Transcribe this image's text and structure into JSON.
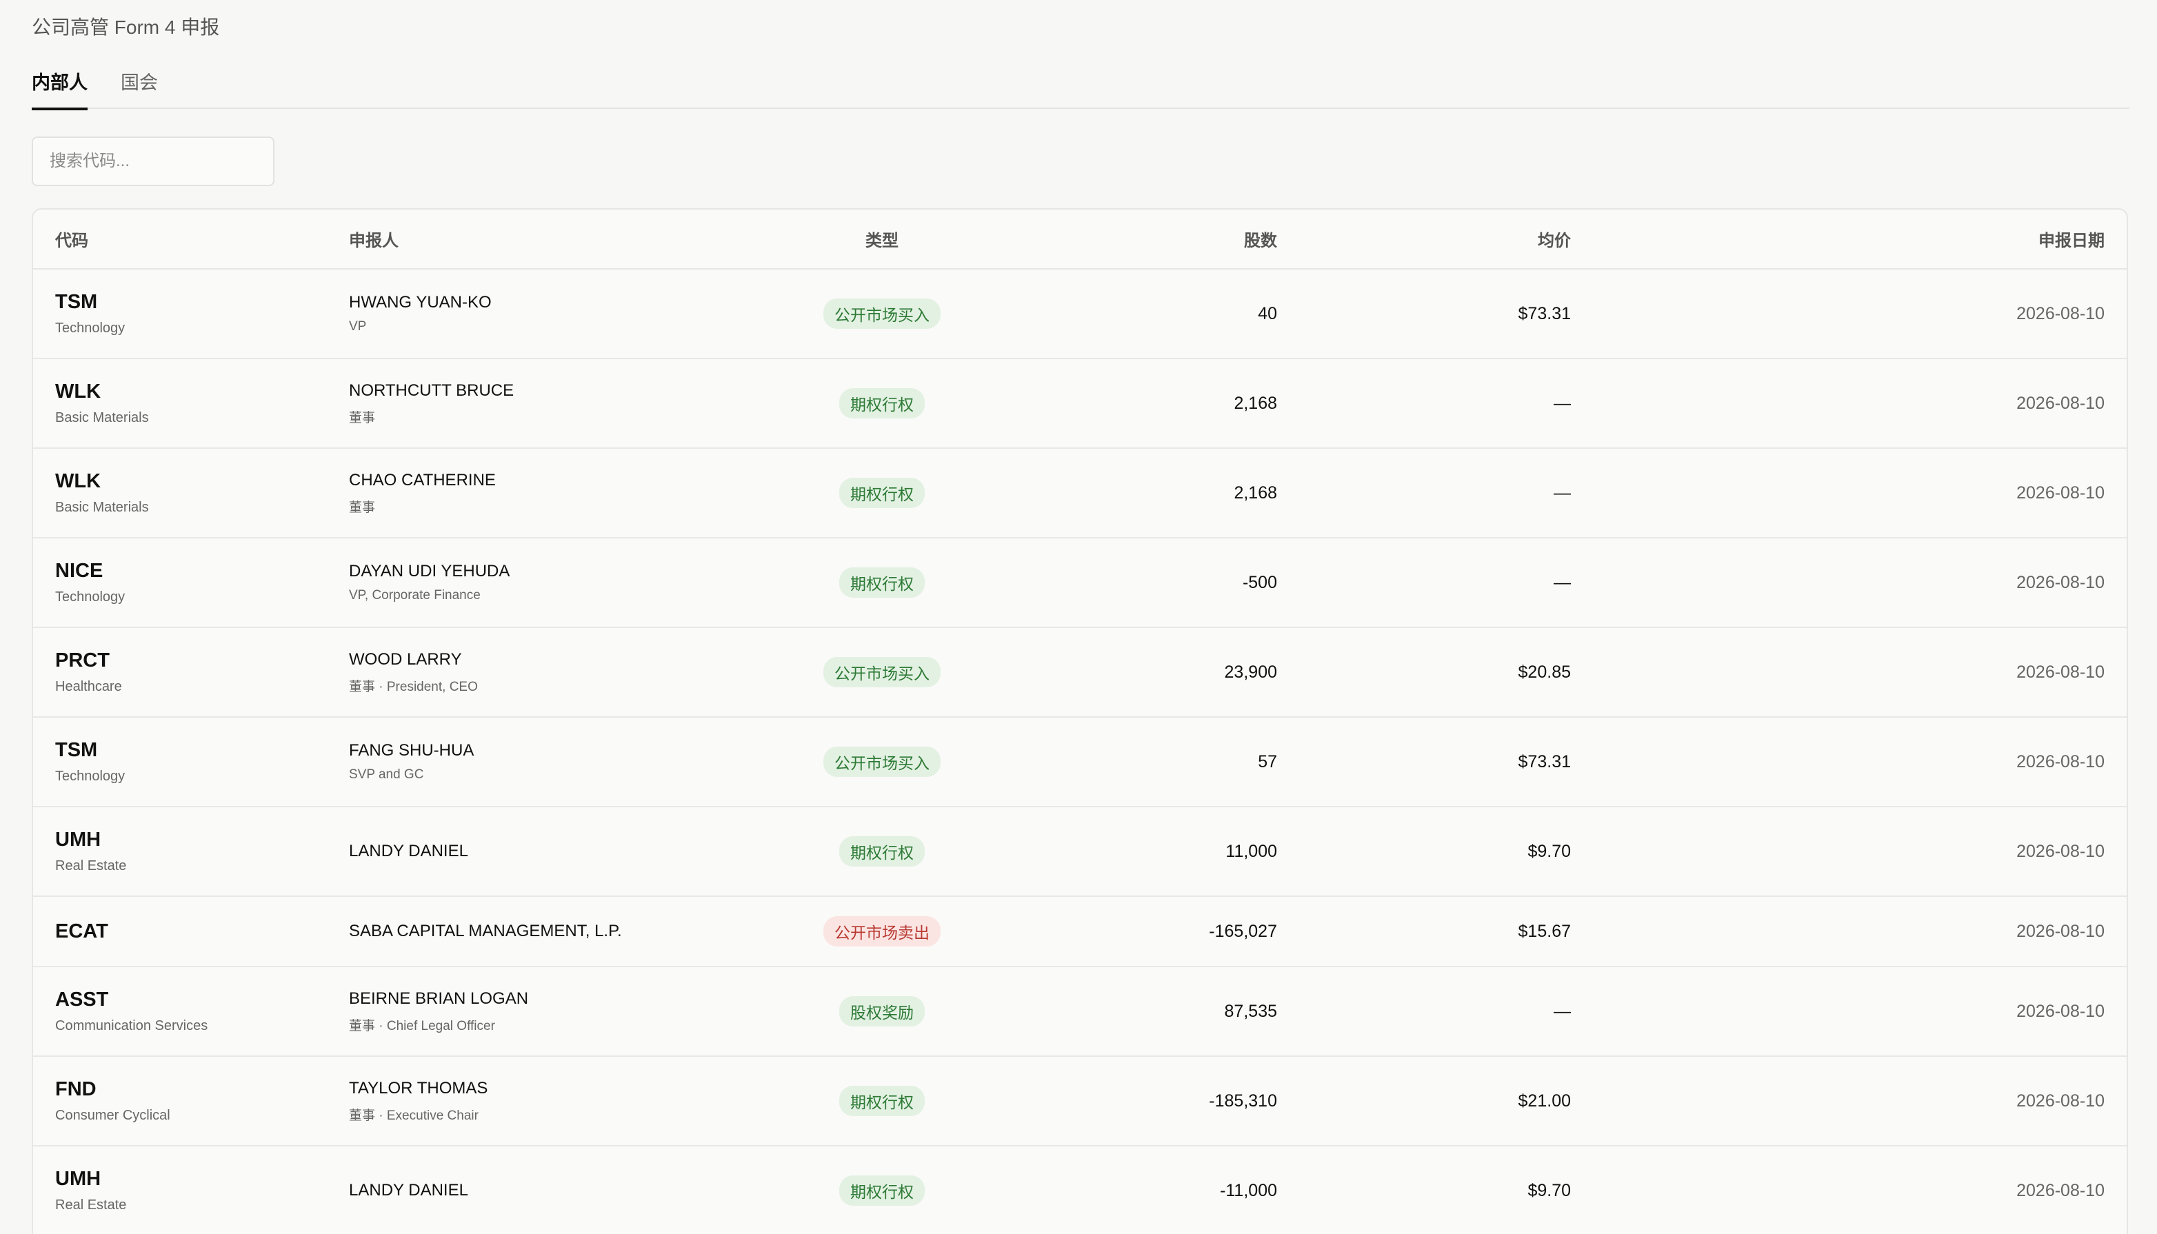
{
  "page_title": "公司高管 Form 4 申报",
  "tabs": [
    {
      "label": "内部人",
      "active": true
    },
    {
      "label": "国会",
      "active": false
    }
  ],
  "search": {
    "placeholder": "搜索代码..."
  },
  "table": {
    "headers": {
      "ticker": "代码",
      "filer": "申报人",
      "type": "类型",
      "shares": "股数",
      "avg_price": "均价",
      "date": "申报日期"
    },
    "rows": [
      {
        "ticker": "TSM",
        "sector": "Technology",
        "filer": "HWANG YUAN-KO",
        "role": "VP",
        "type": "公开市场买入",
        "type_color": "green",
        "shares": "40",
        "price": "$73.31",
        "date": "2026-08-10"
      },
      {
        "ticker": "WLK",
        "sector": "Basic Materials",
        "filer": "NORTHCUTT BRUCE",
        "role": "董事",
        "type": "期权行权",
        "type_color": "green",
        "shares": "2,168",
        "price": "—",
        "date": "2026-08-10"
      },
      {
        "ticker": "WLK",
        "sector": "Basic Materials",
        "filer": "CHAO CATHERINE",
        "role": "董事",
        "type": "期权行权",
        "type_color": "green",
        "shares": "2,168",
        "price": "—",
        "date": "2026-08-10"
      },
      {
        "ticker": "NICE",
        "sector": "Technology",
        "filer": "DAYAN UDI YEHUDA",
        "role": "VP, Corporate Finance",
        "type": "期权行权",
        "type_color": "green",
        "shares": "-500",
        "price": "—",
        "date": "2026-08-10"
      },
      {
        "ticker": "PRCT",
        "sector": "Healthcare",
        "filer": "WOOD LARRY",
        "role": "董事 · President, CEO",
        "type": "公开市场买入",
        "type_color": "green",
        "shares": "23,900",
        "price": "$20.85",
        "date": "2026-08-10"
      },
      {
        "ticker": "TSM",
        "sector": "Technology",
        "filer": "FANG SHU-HUA",
        "role": "SVP and GC",
        "type": "公开市场买入",
        "type_color": "green",
        "shares": "57",
        "price": "$73.31",
        "date": "2026-08-10"
      },
      {
        "ticker": "UMH",
        "sector": "Real Estate",
        "filer": "LANDY DANIEL",
        "role": "",
        "type": "期权行权",
        "type_color": "green",
        "shares": "11,000",
        "price": "$9.70",
        "date": "2026-08-10"
      },
      {
        "ticker": "ECAT",
        "sector": "",
        "filer": "SABA CAPITAL MANAGEMENT, L.P.",
        "role": "",
        "type": "公开市场卖出",
        "type_color": "red",
        "shares": "-165,027",
        "price": "$15.67",
        "date": "2026-08-10"
      },
      {
        "ticker": "ASST",
        "sector": "Communication Services",
        "filer": "BEIRNE BRIAN LOGAN",
        "role": "董事 · Chief Legal Officer",
        "type": "股权奖励",
        "type_color": "green",
        "shares": "87,535",
        "price": "—",
        "date": "2026-08-10"
      },
      {
        "ticker": "FND",
        "sector": "Consumer Cyclical",
        "filer": "TAYLOR THOMAS",
        "role": "董事 · Executive Chair",
        "type": "期权行权",
        "type_color": "green",
        "shares": "-185,310",
        "price": "$21.00",
        "date": "2026-08-10"
      },
      {
        "ticker": "UMH",
        "sector": "Real Estate",
        "filer": "LANDY DANIEL",
        "role": "",
        "type": "期权行权",
        "type_color": "green",
        "shares": "-11,000",
        "price": "$9.70",
        "date": "2026-08-10"
      }
    ]
  }
}
